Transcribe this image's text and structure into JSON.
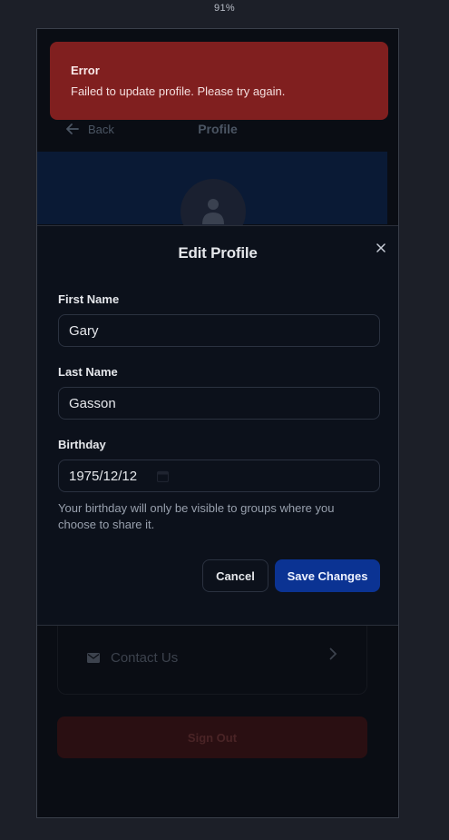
{
  "zoom": "91%",
  "toast": {
    "title": "Error",
    "message": "Failed to update profile. Please try again."
  },
  "header": {
    "back_label": "Back",
    "title": "Profile"
  },
  "modal": {
    "title": "Edit Profile",
    "first_name": {
      "label": "First Name",
      "value": "Gary"
    },
    "last_name": {
      "label": "Last Name",
      "value": "Gasson"
    },
    "birthday": {
      "label": "Birthday",
      "value": "1975/12/12",
      "helper": "Your birthday will only be visible to groups where you choose to share it."
    },
    "cancel_label": "Cancel",
    "save_label": "Save Changes"
  },
  "background": {
    "contact_label": "Contact Us",
    "signout_label": "Sign Out"
  },
  "colors": {
    "toast_bg": "#801f1f",
    "primary": "#0b3393",
    "page_bg": "#0a0d14"
  }
}
